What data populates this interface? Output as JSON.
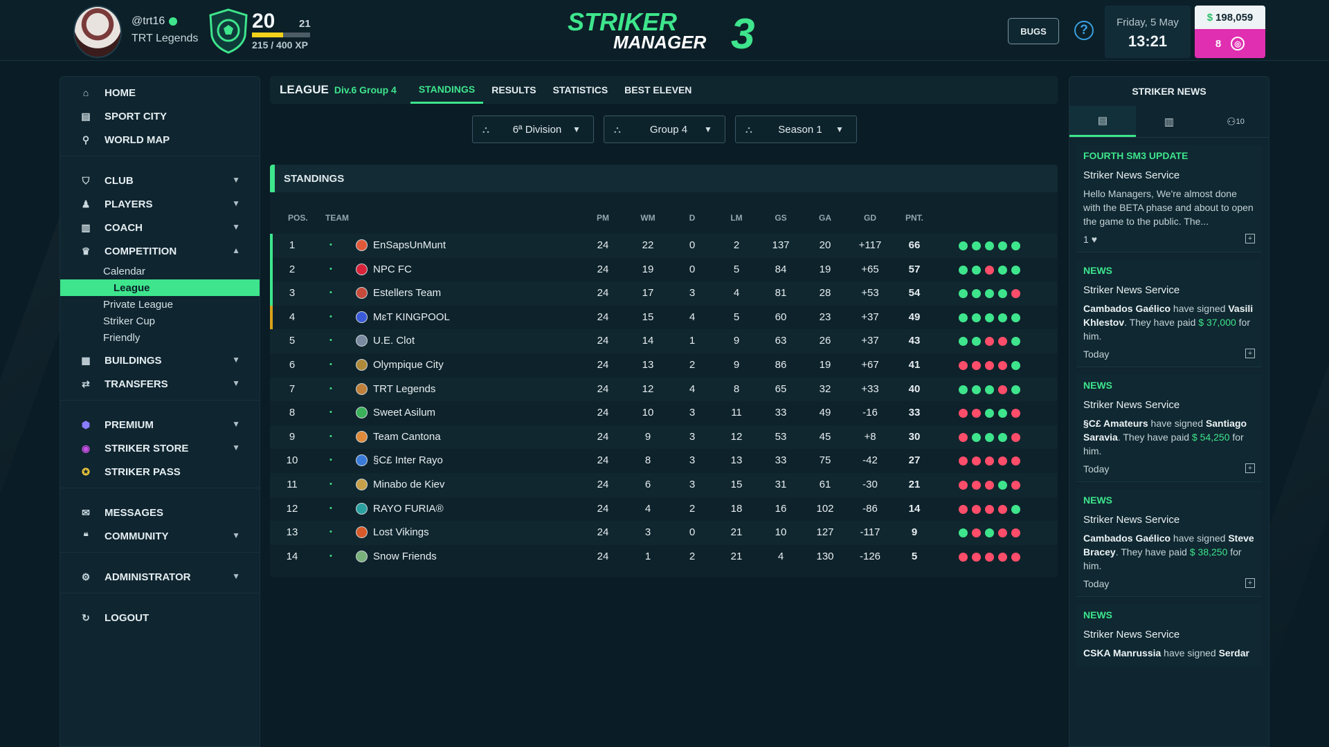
{
  "user": {
    "handle": "@trt16",
    "club": "TRT Legends",
    "level": "20",
    "next_level": "21",
    "xp_text": "215 / 400 XP",
    "xp_progress": 0.54
  },
  "brand": {
    "line1": "STRIKER",
    "line2": "MANAGER",
    "num": "3"
  },
  "header": {
    "bugs_label": "BUGS",
    "help_label": "?",
    "date": "Friday, 5 May",
    "time": "13:21",
    "money": "198,059",
    "money_symbol": "$",
    "coins": "8"
  },
  "colors": {
    "accent": "#3ee58c",
    "win": "#3ee58c",
    "loss": "#ff4d6a",
    "pink": "#e02fb0"
  },
  "sidebar": {
    "home": "HOME",
    "sport_city": "SPORT CITY",
    "world_map": "WORLD MAP",
    "club": "CLUB",
    "players": "PLAYERS",
    "coach": "COACH",
    "competition": "COMPETITION",
    "sub": [
      "Calendar",
      "League",
      "Private League",
      "Striker Cup",
      "Friendly"
    ],
    "buildings": "BUILDINGS",
    "transfers": "TRANSFERS",
    "premium": "PREMIUM",
    "striker_store": "STRIKER STORE",
    "striker_pass": "STRIKER PASS",
    "messages": "MESSAGES",
    "community": "COMMUNITY",
    "administrator": "ADMINISTRATOR",
    "logout": "LOGOUT"
  },
  "league": {
    "title": "LEAGUE",
    "division": "Div.6 Group 4",
    "tabs": [
      "STANDINGS",
      "RESULTS",
      "STATISTICS",
      "BEST ELEVEN"
    ]
  },
  "filters": {
    "division": "6ª Division",
    "group": "Group 4",
    "season": "Season 1"
  },
  "standings": {
    "title": "STANDINGS",
    "headers": [
      "POS.",
      "TEAM",
      "PM",
      "WM",
      "D",
      "LM",
      "GS",
      "GA",
      "GD",
      "PNT."
    ],
    "rows": [
      {
        "pos": "1",
        "team": "EnSapsUnMunt",
        "pm": "24",
        "wm": "22",
        "d": "0",
        "lm": "2",
        "gs": "137",
        "ga": "20",
        "gd": "+117",
        "pnt": "66",
        "form": [
          "W",
          "W",
          "W",
          "W",
          "W"
        ]
      },
      {
        "pos": "2",
        "team": "NPC FC",
        "pm": "24",
        "wm": "19",
        "d": "0",
        "lm": "5",
        "gs": "84",
        "ga": "19",
        "gd": "+65",
        "pnt": "57",
        "form": [
          "W",
          "W",
          "L",
          "W",
          "W"
        ]
      },
      {
        "pos": "3",
        "team": "Estellers Team",
        "pm": "24",
        "wm": "17",
        "d": "3",
        "lm": "4",
        "gs": "81",
        "ga": "28",
        "gd": "+53",
        "pnt": "54",
        "form": [
          "W",
          "W",
          "W",
          "W",
          "L"
        ]
      },
      {
        "pos": "4",
        "team": "MɛT KINGPOOL",
        "pm": "24",
        "wm": "15",
        "d": "4",
        "lm": "5",
        "gs": "60",
        "ga": "23",
        "gd": "+37",
        "pnt": "49",
        "form": [
          "W",
          "W",
          "W",
          "W",
          "W"
        ]
      },
      {
        "pos": "5",
        "team": "U.E. Clot",
        "pm": "24",
        "wm": "14",
        "d": "1",
        "lm": "9",
        "gs": "63",
        "ga": "26",
        "gd": "+37",
        "pnt": "43",
        "form": [
          "W",
          "W",
          "L",
          "L",
          "W"
        ]
      },
      {
        "pos": "6",
        "team": "Olympique City",
        "pm": "24",
        "wm": "13",
        "d": "2",
        "lm": "9",
        "gs": "86",
        "ga": "19",
        "gd": "+67",
        "pnt": "41",
        "form": [
          "L",
          "L",
          "L",
          "L",
          "W"
        ]
      },
      {
        "pos": "7",
        "team": "TRT Legends",
        "pm": "24",
        "wm": "12",
        "d": "4",
        "lm": "8",
        "gs": "65",
        "ga": "32",
        "gd": "+33",
        "pnt": "40",
        "form": [
          "W",
          "W",
          "W",
          "L",
          "W"
        ]
      },
      {
        "pos": "8",
        "team": "Sweet Asilum",
        "pm": "24",
        "wm": "10",
        "d": "3",
        "lm": "11",
        "gs": "33",
        "ga": "49",
        "gd": "-16",
        "pnt": "33",
        "form": [
          "L",
          "L",
          "W",
          "W",
          "L"
        ]
      },
      {
        "pos": "9",
        "team": "Team Cantona",
        "pm": "24",
        "wm": "9",
        "d": "3",
        "lm": "12",
        "gs": "53",
        "ga": "45",
        "gd": "+8",
        "pnt": "30",
        "form": [
          "L",
          "W",
          "W",
          "W",
          "L"
        ]
      },
      {
        "pos": "10",
        "team": "§C£ Inter Rayo",
        "pm": "24",
        "wm": "8",
        "d": "3",
        "lm": "13",
        "gs": "33",
        "ga": "75",
        "gd": "-42",
        "pnt": "27",
        "form": [
          "L",
          "L",
          "L",
          "L",
          "L"
        ]
      },
      {
        "pos": "11",
        "team": "Minabo de Kiev",
        "pm": "24",
        "wm": "6",
        "d": "3",
        "lm": "15",
        "gs": "31",
        "ga": "61",
        "gd": "-30",
        "pnt": "21",
        "form": [
          "L",
          "L",
          "L",
          "W",
          "L"
        ]
      },
      {
        "pos": "12",
        "team": "RAYO FURIA®",
        "pm": "24",
        "wm": "4",
        "d": "2",
        "lm": "18",
        "gs": "16",
        "ga": "102",
        "gd": "-86",
        "pnt": "14",
        "form": [
          "L",
          "L",
          "L",
          "L",
          "W"
        ]
      },
      {
        "pos": "13",
        "team": "Lost Vikings",
        "pm": "24",
        "wm": "3",
        "d": "0",
        "lm": "21",
        "gs": "10",
        "ga": "127",
        "gd": "-117",
        "pnt": "9",
        "form": [
          "W",
          "L",
          "W",
          "L",
          "L"
        ]
      },
      {
        "pos": "14",
        "team": "Snow Friends",
        "pm": "24",
        "wm": "1",
        "d": "2",
        "lm": "21",
        "gs": "4",
        "ga": "130",
        "gd": "-126",
        "pnt": "5",
        "form": [
          "L",
          "L",
          "L",
          "L",
          "L"
        ]
      }
    ]
  },
  "news": {
    "title": "STRIKER NEWS",
    "tab_badge": "10",
    "items": [
      {
        "heading": "FOURTH SM3 UPDATE",
        "source": "Striker News Service",
        "body": "Hello Managers, We're almost done with the BETA phase and about to open the game to the public. The...",
        "likes": "1"
      },
      {
        "heading": "NEWS",
        "source": "Striker News Service",
        "club": "Cambados Gaélico",
        "mid": " have signed ",
        "player": "Vasili Khlestov",
        "tail": ". They have paid ",
        "amount": "$ 37,000",
        "end": " for him.",
        "footer": "Today"
      },
      {
        "heading": "NEWS",
        "source": "Striker News Service",
        "club": "§C£ Amateurs",
        "mid": " have signed ",
        "player": "Santiago Saravia",
        "tail": ". They have paid ",
        "amount": "$ 54,250",
        "end": " for him.",
        "footer": "Today"
      },
      {
        "heading": "NEWS",
        "source": "Striker News Service",
        "club": "Cambados Gaélico",
        "mid": " have signed ",
        "player": "Steve Bracey",
        "tail": ". They have paid ",
        "amount": "$ 38,250",
        "end": " for him.",
        "footer": "Today"
      },
      {
        "heading": "NEWS",
        "source": "Striker News Service",
        "club": "CSKA Manrussia",
        "mid": " have signed ",
        "player": "Serdar"
      }
    ]
  }
}
